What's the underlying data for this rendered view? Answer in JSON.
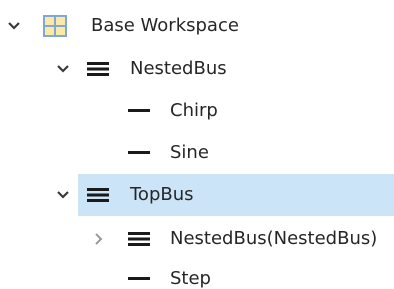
{
  "tree": {
    "root": {
      "label": "Base Workspace",
      "icon": "workspace-grid-icon",
      "expanded": true
    },
    "nodes": [
      {
        "label": "NestedBus",
        "icon": "bus-icon",
        "expanded": true
      },
      {
        "label": "Chirp",
        "icon": "signal-line-icon"
      },
      {
        "label": "Sine",
        "icon": "signal-line-icon"
      },
      {
        "label": "TopBus",
        "icon": "bus-icon",
        "expanded": true,
        "selected": true
      },
      {
        "label": "NestedBus(NestedBus)",
        "icon": "bus-icon",
        "expanded": false
      },
      {
        "label": "Step",
        "icon": "signal-line-icon"
      }
    ]
  },
  "colors": {
    "selection": "#cce4f7",
    "bus_icon": "#1a1a1a",
    "workspace_icon_fill": "#fde9a6",
    "workspace_icon_stroke": "#7fa8d6",
    "text": "#262626"
  }
}
